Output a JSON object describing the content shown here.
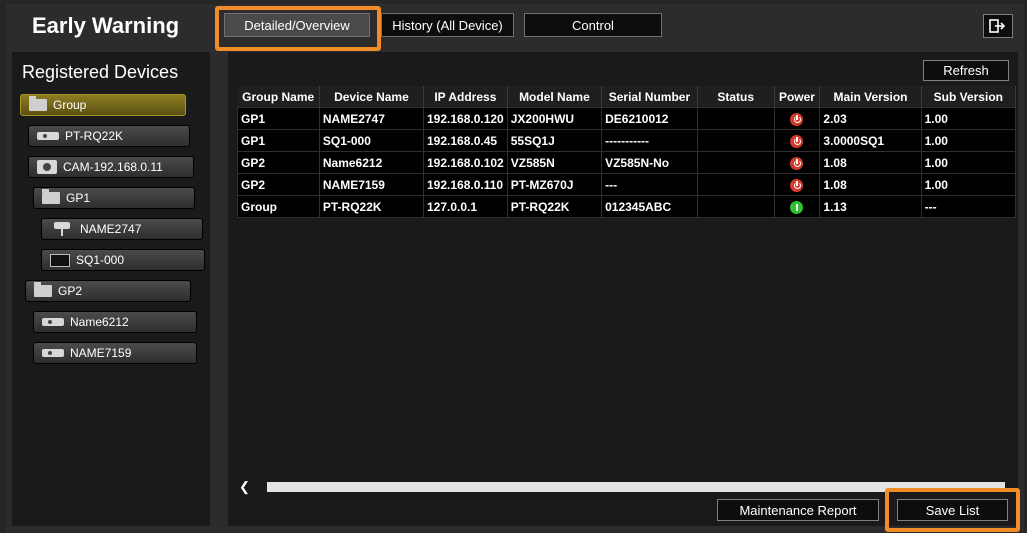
{
  "app": {
    "title": "Early Warning"
  },
  "tabs": [
    {
      "label": "Detailed/Overview"
    },
    {
      "label": "History (All Device)"
    },
    {
      "label": "Control"
    }
  ],
  "sidebar": {
    "title": "Registered Devices",
    "items": [
      {
        "label": "Group",
        "icon": "folder-icon"
      },
      {
        "label": "PT-RQ22K",
        "icon": "projector-icon"
      },
      {
        "label": "CAM-192.168.0.11",
        "icon": "camera-icon"
      },
      {
        "label": "GP1",
        "icon": "folder-icon"
      },
      {
        "label": "NAME2747",
        "icon": "ptz-camera-icon"
      },
      {
        "label": "SQ1-000",
        "icon": "monitor-icon"
      },
      {
        "label": "GP2",
        "icon": "folder-icon"
      },
      {
        "label": "Name6212",
        "icon": "projector-icon"
      },
      {
        "label": "NAME7159",
        "icon": "projector-icon"
      }
    ]
  },
  "toolbar": {
    "refresh_label": "Refresh"
  },
  "table": {
    "headers": [
      "Group Name",
      "Device Name",
      "IP Address",
      "Model Name",
      "Serial Number",
      "Status",
      "Power",
      "Main Version",
      "Sub Version"
    ],
    "rows": [
      [
        "GP1",
        "NAME2747",
        "192.168.0.120",
        "JX200HWU",
        "DE6210012",
        "",
        "off",
        "2.03",
        "1.00"
      ],
      [
        "GP1",
        "SQ1-000",
        "192.168.0.45",
        "55SQ1J",
        "-----------",
        "",
        "off",
        "3.0000SQ1",
        "1.00"
      ],
      [
        "GP2",
        "Name6212",
        "192.168.0.102",
        "VZ585N",
        "VZ585N-No",
        "",
        "off",
        "1.08",
        "1.00"
      ],
      [
        "GP2",
        "NAME7159",
        "192.168.0.110",
        "PT-MZ670J",
        "---",
        "",
        "off",
        "1.08",
        "1.00"
      ],
      [
        "Group",
        "PT-RQ22K",
        "127.0.0.1",
        "PT-RQ22K",
        "012345ABC",
        "",
        "on",
        "1.13",
        "---"
      ]
    ]
  },
  "footer": {
    "maintenance_label": "Maintenance Report",
    "save_label": "Save List"
  },
  "colors": {
    "highlight": "#f28c28",
    "selected": "#8d7d20",
    "power_off": "#d63a2a",
    "power_on": "#2fc12f"
  }
}
